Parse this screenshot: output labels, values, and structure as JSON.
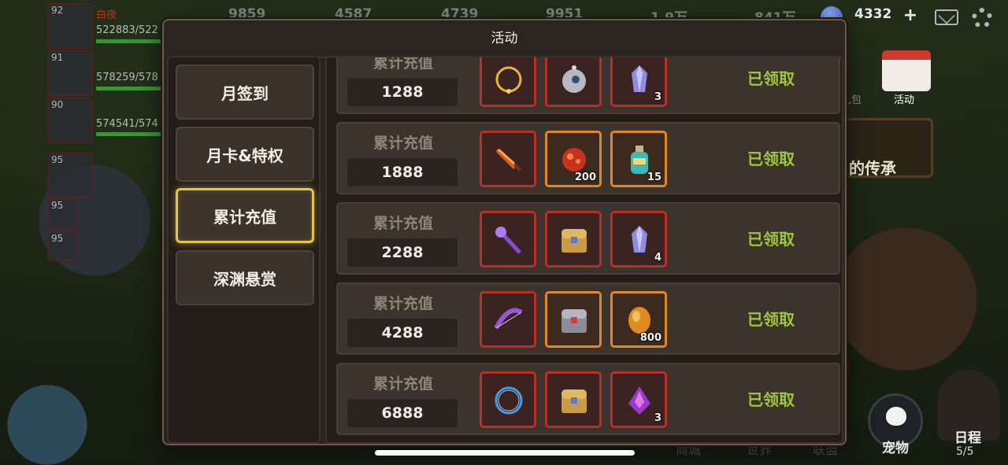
{
  "topbar": {
    "resources": [
      "9859",
      "4587",
      "4739",
      "9951",
      "1.9万",
      "841万"
    ],
    "diamonds": "4332",
    "plus_symbol": "+"
  },
  "heroes": [
    {
      "level": "92",
      "name": "白夜",
      "hp": "522883/522"
    },
    {
      "level": "91",
      "name": "",
      "hp": "578259/578"
    },
    {
      "level": "90",
      "name": "",
      "hp": "574541/574"
    },
    {
      "level": "95",
      "name": "",
      "hp": ""
    },
    {
      "level": "95",
      "name": "",
      "hp": ""
    },
    {
      "level": "95",
      "name": "",
      "hp": ""
    }
  ],
  "side_icons": {
    "gift_label": "礼包",
    "activity_label": "活动",
    "banner_text": "的传承",
    "pet_label": "宠物",
    "schedule_label": "日程",
    "schedule_count": "5/5",
    "bottom_dim_labels": [
      "商城",
      "世界",
      "联盟"
    ]
  },
  "modal": {
    "title": "活动",
    "tabs": [
      {
        "label": "月签到",
        "active": false
      },
      {
        "label": "月卡&特权",
        "active": false
      },
      {
        "label": "累计充值",
        "active": true
      },
      {
        "label": "深渊悬赏",
        "active": false
      }
    ],
    "rows": [
      {
        "title": "累计充值",
        "amount": "1288",
        "status": "已领取",
        "items": [
          {
            "icon": "gold-ring-icon",
            "frame": "red",
            "qty": ""
          },
          {
            "icon": "robot-pet-icon",
            "frame": "red",
            "qty": ""
          },
          {
            "icon": "crystal-icon",
            "frame": "red",
            "qty": "3"
          }
        ]
      },
      {
        "title": "累计充值",
        "amount": "1888",
        "status": "已领取",
        "items": [
          {
            "icon": "flame-sword-icon",
            "frame": "red",
            "qty": ""
          },
          {
            "icon": "red-orb-icon",
            "frame": "orange",
            "qty": "200"
          },
          {
            "icon": "potion-bottle-icon",
            "frame": "orange",
            "qty": "15"
          }
        ]
      },
      {
        "title": "累计充值",
        "amount": "2288",
        "status": "已领取",
        "items": [
          {
            "icon": "purple-staff-icon",
            "frame": "red",
            "qty": ""
          },
          {
            "icon": "treasure-chest-icon",
            "frame": "red",
            "qty": ""
          },
          {
            "icon": "crystal-icon",
            "frame": "red",
            "qty": "4"
          }
        ]
      },
      {
        "title": "累计充值",
        "amount": "4288",
        "status": "已领取",
        "items": [
          {
            "icon": "purple-bow-icon",
            "frame": "red",
            "qty": ""
          },
          {
            "icon": "silver-chest-icon",
            "frame": "orange",
            "qty": ""
          },
          {
            "icon": "amber-gem-icon",
            "frame": "orange",
            "qty": "800"
          }
        ]
      },
      {
        "title": "累计充值",
        "amount": "6888",
        "status": "已领取",
        "items": [
          {
            "icon": "blue-ring-icon",
            "frame": "red",
            "qty": ""
          },
          {
            "icon": "treasure-chest-icon",
            "frame": "red",
            "qty": ""
          },
          {
            "icon": "purple-potion-icon",
            "frame": "red",
            "qty": "3"
          }
        ]
      }
    ]
  }
}
